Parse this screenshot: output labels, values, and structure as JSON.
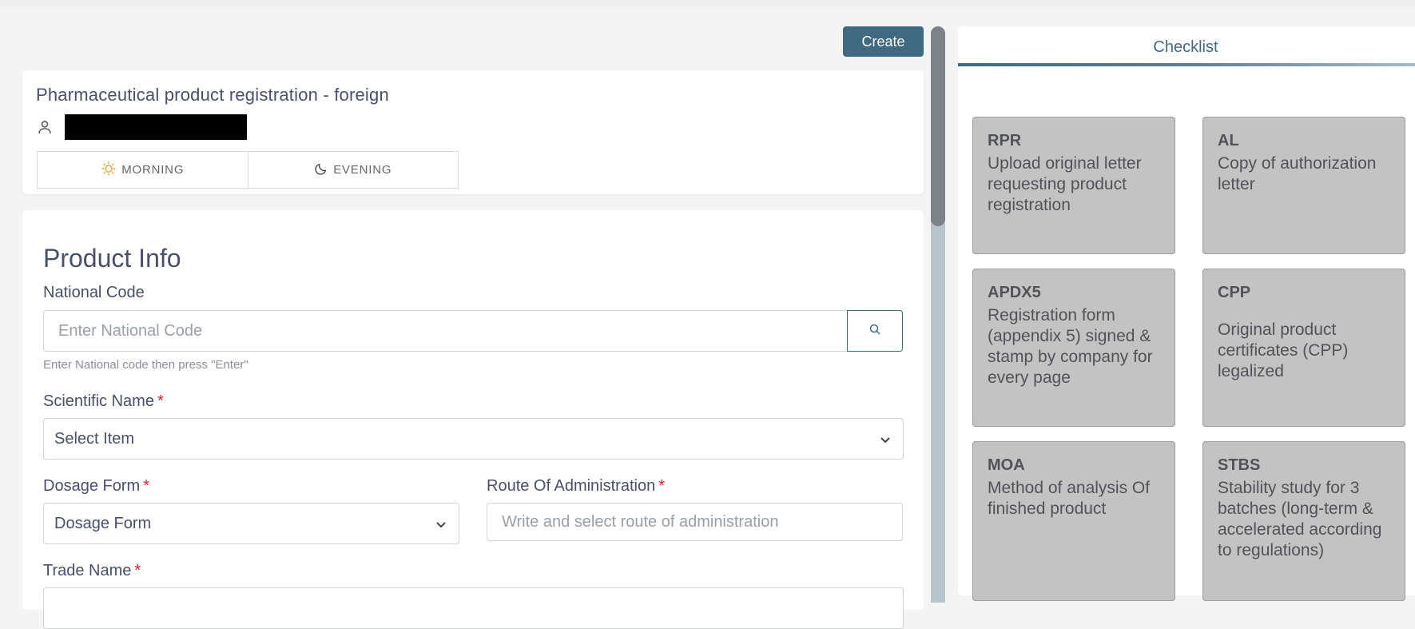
{
  "toolbar": {
    "create_label": "Create"
  },
  "header": {
    "title": "Pharmaceutical product registration - foreign",
    "shifts": [
      {
        "label": "MORNING",
        "icon": "sun-icon"
      },
      {
        "label": "EVENING",
        "icon": "moon-icon"
      }
    ]
  },
  "form": {
    "section_title": "Product Info",
    "national_code": {
      "label": "National Code",
      "placeholder": "Enter National Code",
      "hint": "Enter National code then press \"Enter\""
    },
    "scientific_name": {
      "label": "Scientific Name",
      "required": "*",
      "value": "Select Item"
    },
    "dosage_form": {
      "label": "Dosage Form",
      "required": "*",
      "value": "Dosage Form"
    },
    "route": {
      "label": "Route Of Administration",
      "required": "*",
      "placeholder": "Write and select route of administration"
    },
    "trade_name": {
      "label": "Trade Name",
      "required": "*"
    }
  },
  "checklist": {
    "tab_label": "Checklist",
    "items": [
      {
        "code": "RPR",
        "desc": "Upload original letter requesting product registration"
      },
      {
        "code": "AL",
        "desc": "Copy of authorization letter"
      },
      {
        "code": "APDX5",
        "desc": "Registration form (appendix 5) signed & stamp by company for every page"
      },
      {
        "code": "CPP",
        "desc": "Original product certificates (CPP) legalized"
      },
      {
        "code": "MOA",
        "desc": "Method of analysis Of finished product"
      },
      {
        "code": "STBS",
        "desc": "Stability study for 3 batches (long-term & accelerated according to regulations)"
      }
    ]
  },
  "colors": {
    "accent": "#3f6a82",
    "required": "#e0232b",
    "card_bg": "#c3c3c3"
  }
}
